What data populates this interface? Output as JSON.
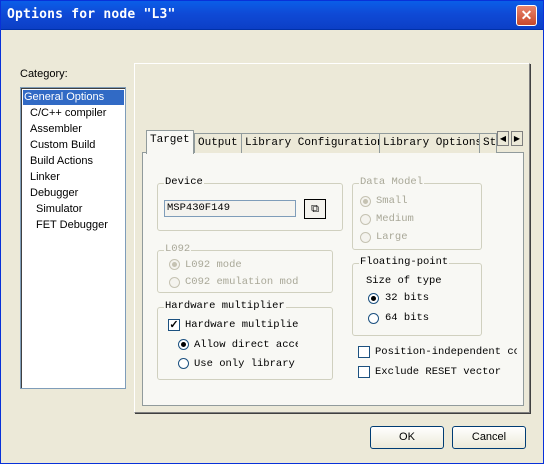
{
  "window": {
    "title": "Options for node \"L3\""
  },
  "category": {
    "label": "Category:",
    "items": [
      "General Options",
      "C/C++ compiler",
      "Assembler",
      "Custom Build",
      "Build Actions",
      "Linker",
      "Debugger",
      "Simulator",
      "FET Debugger"
    ],
    "selected": "General Options"
  },
  "tabs": [
    "Target",
    "Output",
    "Library Configuration",
    "Library Options",
    "St"
  ],
  "target": {
    "device": {
      "label": "Device",
      "value": "MSP430F149"
    },
    "data_model": {
      "label": "Data Model",
      "options": [
        "Small",
        "Medium",
        "Large"
      ],
      "selected": "Small"
    },
    "l092": {
      "label": "L092",
      "options": [
        "L092 mode",
        "C092 emulation mod"
      ],
      "selected": "L092 mode"
    },
    "floating_point": {
      "label": "Floating-point",
      "size_label": "Size of type",
      "options": [
        "32 bits",
        "64 bits"
      ],
      "selected": "32 bits"
    },
    "hw_mult": {
      "label": "Hardware multiplier",
      "checkbox": "Hardware multiplier",
      "checked": true,
      "options": [
        "Allow direct acce:",
        "Use only library ("
      ],
      "selected": "Allow direct acce:"
    },
    "pic": {
      "label": "Position-independent coc",
      "checked": false
    },
    "exclude_reset": {
      "label": "Exclude RESET vector",
      "checked": false
    }
  },
  "buttons": {
    "ok": "OK",
    "cancel": "Cancel"
  }
}
